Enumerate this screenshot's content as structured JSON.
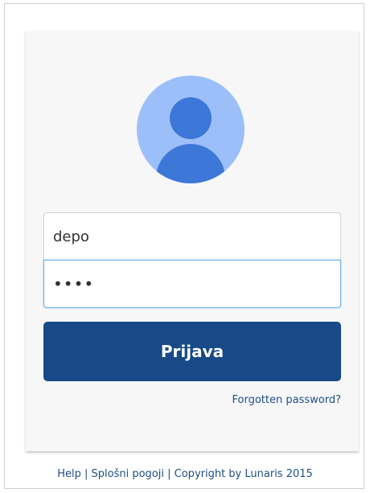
{
  "login": {
    "username_value": "depo",
    "password_value": "pass",
    "submit_label": "Prijava",
    "forgot_label": "Forgotten password?"
  },
  "avatar": {
    "icon": "user-avatar-icon",
    "bg_color": "#9dbff9",
    "fg_color": "#3d77d8"
  },
  "footer": {
    "help": "Help",
    "sep1": "|",
    "terms": "Splošni pogoji",
    "sep2": "|",
    "copyright": "Copyright by Lunaris 2015"
  },
  "colors": {
    "button": "#174a86",
    "link": "#1f4e85",
    "focus_border": "#66afe9"
  }
}
